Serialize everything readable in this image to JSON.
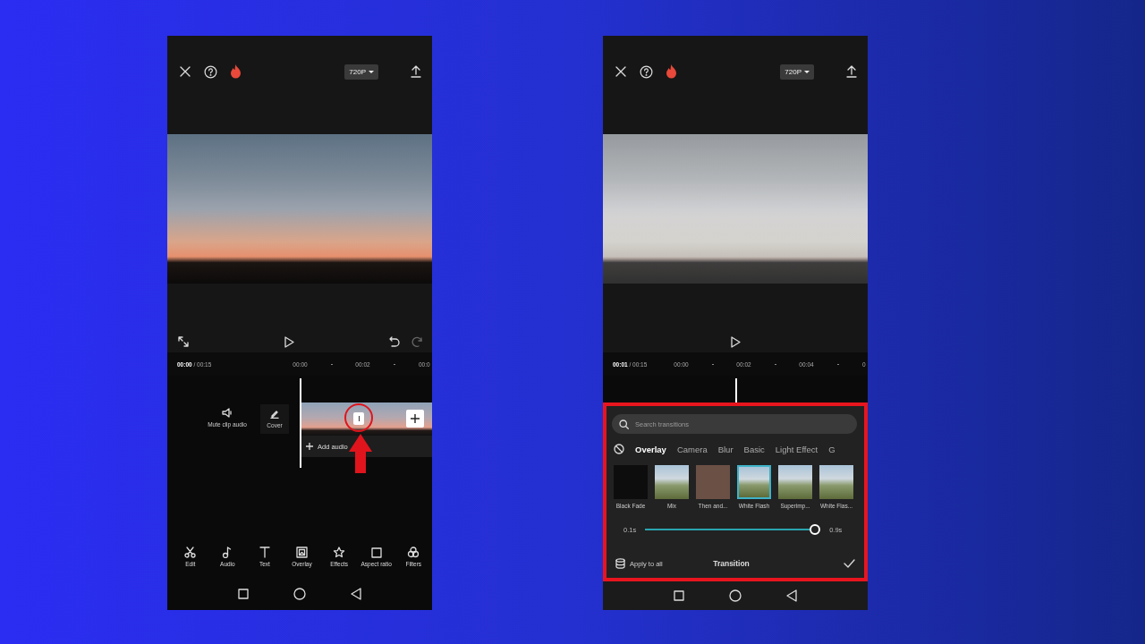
{
  "screens": [
    {
      "kind": "editor",
      "resolution": "720P",
      "current_time": "00:00",
      "total_time": "/ 00:15",
      "ruler": [
        "00:00",
        "00:02",
        "00:0"
      ],
      "clip_actions": [
        {
          "label": "Mute clip audio"
        },
        {
          "label": "Cover"
        }
      ],
      "add_audio": "Add audio",
      "tools": [
        {
          "label": "Edit"
        },
        {
          "label": "Audio"
        },
        {
          "label": "Text"
        },
        {
          "label": "Overlay"
        },
        {
          "label": "Effects"
        },
        {
          "label": "Aspect ratio"
        },
        {
          "label": "Filters"
        }
      ]
    },
    {
      "kind": "transitions",
      "resolution": "720P",
      "current_time": "00:01",
      "total_time": "/ 00:15",
      "ruler": [
        "00:00",
        "00:02",
        "00:04",
        "0"
      ],
      "search": {
        "placeholder": "Search transitions"
      },
      "categories": [
        {
          "label": "Overlay",
          "selected": true
        },
        {
          "label": "Camera",
          "selected": false
        },
        {
          "label": "Blur",
          "selected": false
        },
        {
          "label": "Basic",
          "selected": false
        },
        {
          "label": "Light Effect",
          "selected": false
        },
        {
          "label": "G",
          "selected": false
        }
      ],
      "transitions": [
        {
          "label": "Black Fade",
          "selected": false
        },
        {
          "label": "Mix",
          "selected": false
        },
        {
          "label": "Then and...",
          "selected": false
        },
        {
          "label": "White Flash",
          "selected": true
        },
        {
          "label": "Superimp...",
          "selected": false
        },
        {
          "label": "White Flas...",
          "selected": false
        }
      ],
      "duration": {
        "min": "0.1s",
        "max": "0.9s",
        "level": 1
      },
      "apply_all": "Apply to all",
      "panel_title": "Transition"
    }
  ]
}
